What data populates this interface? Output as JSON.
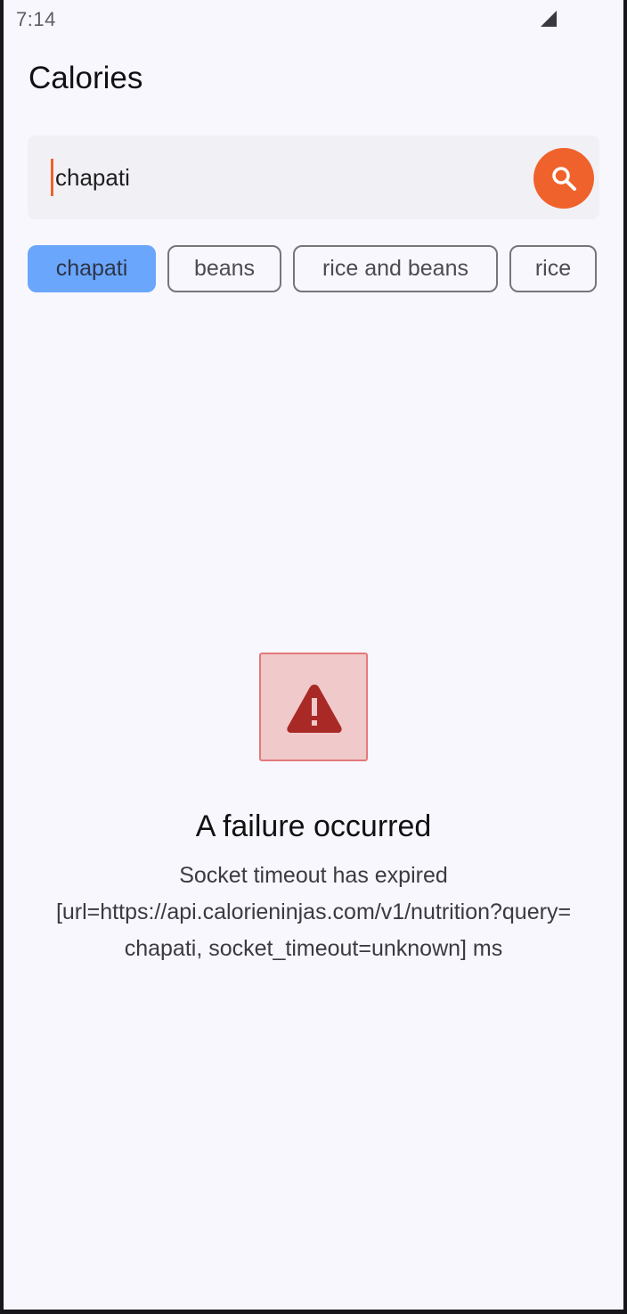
{
  "status_bar": {
    "time": "7:14",
    "signal_icon": "cell-signal-icon"
  },
  "header": {
    "title": "Calories"
  },
  "search": {
    "value": "chapati",
    "button_icon": "search-icon",
    "accent_color": "#f0622b"
  },
  "chips": [
    {
      "label": "chapati",
      "selected": true
    },
    {
      "label": "beans",
      "selected": false
    },
    {
      "label": "rice and beans",
      "selected": false
    },
    {
      "label": "rice",
      "selected": false
    }
  ],
  "error": {
    "icon": "warning-icon",
    "title": "A failure occurred",
    "message_line1": "Socket timeout has expired",
    "message_line2": "[url=https://api.calorieninjas.com/v1/nutrition?query=",
    "message_line3": "chapati, socket_timeout=unknown] ms",
    "icon_color": "#a82925",
    "icon_bg_color": "#f0c9cb"
  },
  "colors": {
    "chip_selected": "#6aa6fb",
    "background": "#f8f7fd"
  }
}
